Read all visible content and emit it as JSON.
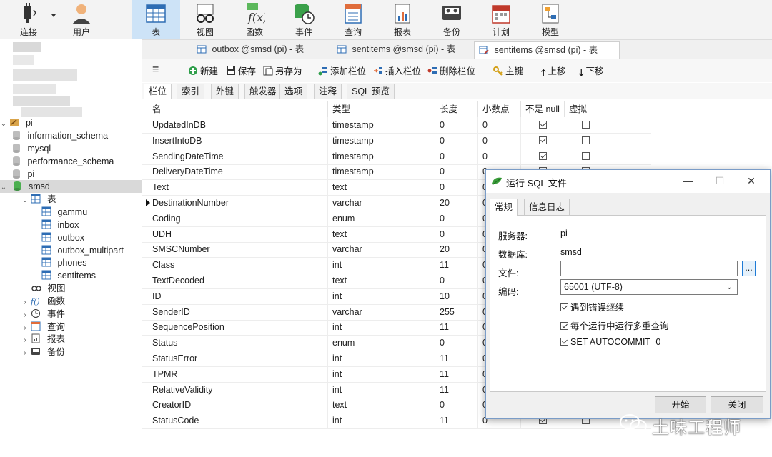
{
  "ribbon": {
    "items": [
      {
        "label": "连接",
        "icon": "plug-icon"
      },
      {
        "label": "用户",
        "icon": "user-icon"
      },
      {
        "label": "表",
        "icon": "table-icon"
      },
      {
        "label": "视图",
        "icon": "glasses-icon"
      },
      {
        "label": "函数",
        "icon": "function-icon"
      },
      {
        "label": "事件",
        "icon": "event-clock-icon"
      },
      {
        "label": "查询",
        "icon": "query-icon"
      },
      {
        "label": "报表",
        "icon": "report-icon"
      },
      {
        "label": "备份",
        "icon": "backup-icon"
      },
      {
        "label": "计划",
        "icon": "calendar-icon"
      },
      {
        "label": "模型",
        "icon": "model-icon"
      }
    ],
    "active": "表"
  },
  "tree": {
    "connection": "pi",
    "databases": [
      "information_schema",
      "mysql",
      "performance_schema",
      "pi",
      "smsd"
    ],
    "selected_db": "smsd",
    "tables_label": "表",
    "tables": [
      "gammu",
      "inbox",
      "outbox",
      "outbox_multipart",
      "phones",
      "sentitems"
    ],
    "other_nodes": [
      "视图",
      "函数",
      "事件",
      "查询",
      "报表",
      "备份"
    ]
  },
  "doc_tabs": [
    {
      "label": "outbox @smsd (pi) - 表",
      "active": false
    },
    {
      "label": "sentitems @smsd (pi) - 表",
      "active": false
    },
    {
      "label": "sentitems @smsd (pi) - 表",
      "active": true
    }
  ],
  "toolbar": {
    "menu": "≡",
    "new": "新建",
    "save": "保存",
    "save_as": "另存为",
    "add_field": "添加栏位",
    "insert_field": "插入栏位",
    "delete_field": "删除栏位",
    "primary_key": "主键",
    "move_up": "上移",
    "move_down": "下移"
  },
  "sub_tabs": [
    "栏位",
    "索引",
    "外键",
    "触发器",
    "选项",
    "注释",
    "SQL 预览"
  ],
  "grid": {
    "headers": [
      "名",
      "类型",
      "长度",
      "小数点",
      "不是 null",
      "虚拟"
    ],
    "rows": [
      {
        "name": "UpdatedInDB",
        "type": "timestamp",
        "length": "0",
        "decimals": "0",
        "not_null": true,
        "virtual": false
      },
      {
        "name": "InsertIntoDB",
        "type": "timestamp",
        "length": "0",
        "decimals": "0",
        "not_null": true,
        "virtual": false
      },
      {
        "name": "SendingDateTime",
        "type": "timestamp",
        "length": "0",
        "decimals": "0",
        "not_null": true,
        "virtual": false
      },
      {
        "name": "DeliveryDateTime",
        "type": "timestamp",
        "length": "0",
        "decimals": "0",
        "not_null": false,
        "virtual": false
      },
      {
        "name": "Text",
        "type": "text",
        "length": "0",
        "decimals": "0",
        "not_null": false,
        "virtual": false
      },
      {
        "name": "DestinationNumber",
        "type": "varchar",
        "length": "20",
        "decimals": "0",
        "not_null": false,
        "virtual": false
      },
      {
        "name": "Coding",
        "type": "enum",
        "length": "0",
        "decimals": "0",
        "not_null": false,
        "virtual": false
      },
      {
        "name": "UDH",
        "type": "text",
        "length": "0",
        "decimals": "0",
        "not_null": false,
        "virtual": false
      },
      {
        "name": "SMSCNumber",
        "type": "varchar",
        "length": "20",
        "decimals": "0",
        "not_null": false,
        "virtual": false
      },
      {
        "name": "Class",
        "type": "int",
        "length": "11",
        "decimals": "0",
        "not_null": false,
        "virtual": false
      },
      {
        "name": "TextDecoded",
        "type": "text",
        "length": "0",
        "decimals": "0",
        "not_null": false,
        "virtual": false
      },
      {
        "name": "ID",
        "type": "int",
        "length": "10",
        "decimals": "0",
        "not_null": false,
        "virtual": false
      },
      {
        "name": "SenderID",
        "type": "varchar",
        "length": "255",
        "decimals": "0",
        "not_null": false,
        "virtual": false
      },
      {
        "name": "SequencePosition",
        "type": "int",
        "length": "11",
        "decimals": "0",
        "not_null": false,
        "virtual": false
      },
      {
        "name": "Status",
        "type": "enum",
        "length": "0",
        "decimals": "0",
        "not_null": false,
        "virtual": false
      },
      {
        "name": "StatusError",
        "type": "int",
        "length": "11",
        "decimals": "0",
        "not_null": false,
        "virtual": false
      },
      {
        "name": "TPMR",
        "type": "int",
        "length": "11",
        "decimals": "0",
        "not_null": false,
        "virtual": false
      },
      {
        "name": "RelativeValidity",
        "type": "int",
        "length": "11",
        "decimals": "0",
        "not_null": false,
        "virtual": false
      },
      {
        "name": "CreatorID",
        "type": "text",
        "length": "0",
        "decimals": "0",
        "not_null": false,
        "virtual": false
      },
      {
        "name": "StatusCode",
        "type": "int",
        "length": "11",
        "decimals": "0",
        "not_null": true,
        "virtual": false
      }
    ],
    "current_row": "DestinationNumber"
  },
  "dialog": {
    "title": "运行 SQL 文件",
    "tabs": [
      "常规",
      "信息日志"
    ],
    "server_label": "服务器:",
    "server_value": "pi",
    "database_label": "数据库:",
    "database_value": "smsd",
    "file_label": "文件:",
    "file_value": "",
    "browse_label": "...",
    "encoding_label": "编码:",
    "encoding_value": "65001 (UTF-8)",
    "options": [
      {
        "label": "遇到错误继续",
        "checked": true
      },
      {
        "label": "每个运行中运行多重查询",
        "checked": true
      },
      {
        "label": "SET AUTOCOMMIT=0",
        "checked": true
      }
    ],
    "start_button": "开始",
    "close_button": "关闭"
  },
  "watermark": "土味工程师",
  "colors": {
    "ribbon_active": "#cde3f7",
    "accent": "#1e7bd6",
    "dialog_border": "#7a9cc7"
  }
}
